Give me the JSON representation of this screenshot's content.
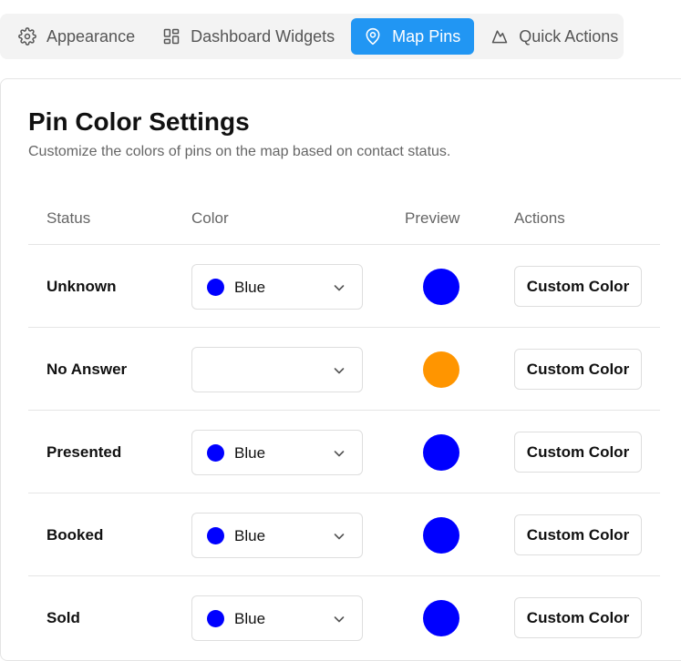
{
  "tabs": [
    {
      "label": "Appearance",
      "icon": "gear-icon",
      "active": false
    },
    {
      "label": "Dashboard Widgets",
      "icon": "widgets-grid-icon",
      "active": false
    },
    {
      "label": "Map Pins",
      "icon": "map-pin-icon",
      "active": true
    },
    {
      "label": "Quick Actions",
      "icon": "mountain-icon",
      "active": false
    }
  ],
  "section": {
    "title": "Pin Color Settings",
    "subtitle": "Customize the colors of pins on the map based on contact status."
  },
  "table": {
    "headers": [
      "Status",
      "Color",
      "Preview",
      "Actions"
    ],
    "rows": [
      {
        "status": "Unknown",
        "color_label": "Blue",
        "color": "#0000ff",
        "preview": "#0000ff",
        "action": "Custom Color"
      },
      {
        "status": "No Answer",
        "color_label": "",
        "color": "",
        "preview": "#ff9500",
        "action": "Custom Color"
      },
      {
        "status": "Presented",
        "color_label": "Blue",
        "color": "#0000ff",
        "preview": "#0000ff",
        "action": "Custom Color"
      },
      {
        "status": "Booked",
        "color_label": "Blue",
        "color": "#0000ff",
        "preview": "#0000ff",
        "action": "Custom Color"
      },
      {
        "status": "Sold",
        "color_label": "Blue",
        "color": "#0000ff",
        "preview": "#0000ff",
        "action": "Custom Color"
      }
    ]
  },
  "colors": {
    "accent": "#2196f3",
    "tab_bar": "#f3f3f3"
  }
}
